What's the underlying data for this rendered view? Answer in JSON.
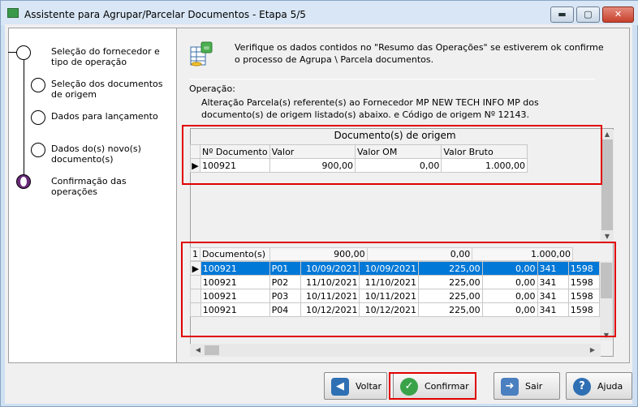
{
  "window": {
    "title": "Assistente para Agrupar/Parcelar Documentos - Etapa 5/5",
    "min_label": "▬",
    "max_label": "▢",
    "close_label": "✕"
  },
  "steps": [
    {
      "label": "Seleção do fornecedor e tipo de operação"
    },
    {
      "label": "Seleção dos documentos de origem"
    },
    {
      "label": "Dados para lançamento"
    },
    {
      "label": "Dados do(s) novo(s) documento(s)"
    },
    {
      "label": "Confirmação das operações"
    }
  ],
  "intro": "Verifique os dados contidos no \"Resumo das Operações\" se estiverem ok confirme o processo de Agrupa \\ Parcela documentos.",
  "operation": {
    "label": "Operação:",
    "text": "Alteração Parcela(s) referente(s) ao Fornecedor MP NEW TECH INFO MP dos documento(s) de origem listado(s) abaixo. e Código de origem Nº 12143."
  },
  "origin_grid": {
    "title": "Documento(s) de origem",
    "columns": [
      "Nº Documento",
      "Valor",
      "Valor OM",
      "Valor Bruto"
    ],
    "rows": [
      {
        "doc": "100921",
        "valor": "900,00",
        "valor_om": "0,00",
        "valor_bruto": "1.000,00"
      }
    ]
  },
  "new_grid": {
    "summary": {
      "count": "1",
      "label": "Documento(s)",
      "valor": "900,00",
      "om": "0,00",
      "bruto": "1.000,00"
    },
    "rows": [
      {
        "doc": "100921",
        "parcela": "P01",
        "data1": "10/09/2021",
        "data2": "10/09/2021",
        "valor": "225,00",
        "om": "0,00",
        "c1": "341",
        "c2": "1598"
      },
      {
        "doc": "100921",
        "parcela": "P02",
        "data1": "11/10/2021",
        "data2": "11/10/2021",
        "valor": "225,00",
        "om": "0,00",
        "c1": "341",
        "c2": "1598"
      },
      {
        "doc": "100921",
        "parcela": "P03",
        "data1": "10/11/2021",
        "data2": "10/11/2021",
        "valor": "225,00",
        "om": "0,00",
        "c1": "341",
        "c2": "1598"
      },
      {
        "doc": "100921",
        "parcela": "P04",
        "data1": "10/12/2021",
        "data2": "10/12/2021",
        "valor": "225,00",
        "om": "0,00",
        "c1": "341",
        "c2": "1598"
      }
    ]
  },
  "buttons": {
    "voltar": "Voltar",
    "confirmar": "Confirmar",
    "sair": "Sair",
    "ajuda": "Ajuda"
  },
  "colors": {
    "accent": "#0078d7",
    "highlight_box": "#e00000"
  }
}
